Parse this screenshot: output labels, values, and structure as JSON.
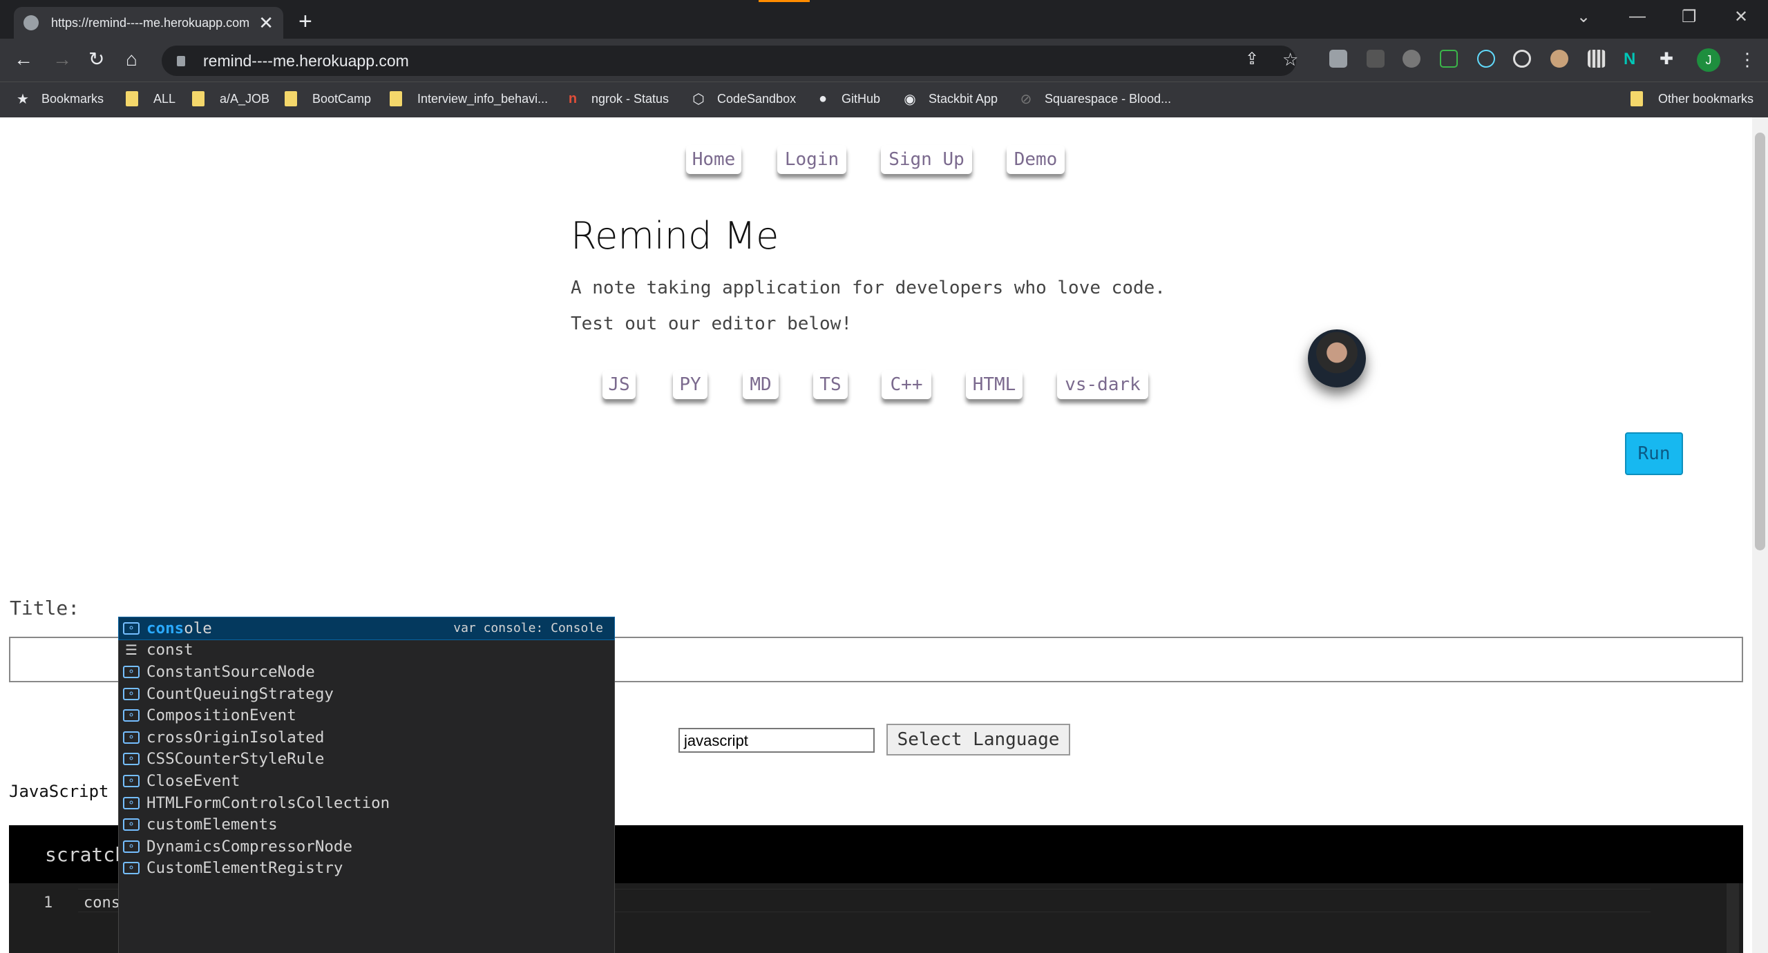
{
  "browser": {
    "tab_title": "https://remind----me.herokuapp.com",
    "tab_close": "✕",
    "new_tab": "+",
    "url": "remind----me.herokuapp.com",
    "profile_initial": "J",
    "bookmarks": [
      {
        "label": "Bookmarks",
        "icon": "star-icon"
      },
      {
        "label": "ALL",
        "icon": "folder-icon"
      },
      {
        "label": "a/A_JOB",
        "icon": "folder-icon"
      },
      {
        "label": "BootCamp",
        "icon": "folder-icon"
      },
      {
        "label": "Interview_info_behavi...",
        "icon": "folder-icon"
      },
      {
        "label": "ngrok - Status",
        "icon": "ngrok-icon"
      },
      {
        "label": "CodeSandbox",
        "icon": "codesandbox-icon"
      },
      {
        "label": "GitHub",
        "icon": "github-icon"
      },
      {
        "label": "Stackbit App",
        "icon": "stackbit-icon"
      },
      {
        "label": "Squarespace - Blood...",
        "icon": "squarespace-icon"
      }
    ],
    "other_bookmarks": "Other bookmarks"
  },
  "nav": {
    "home": "Home",
    "login": "Login",
    "signup": "Sign Up",
    "demo": "Demo"
  },
  "hero": {
    "title": "Remind Me",
    "tagline1": "A note taking application for developers who love code.",
    "tagline2": "Test out our editor below!"
  },
  "languages": [
    "JS",
    "PY",
    "MD",
    "TS",
    "C++",
    "HTML",
    "vs-dark"
  ],
  "run_label": "Run",
  "form": {
    "title_label": "Title:",
    "title_value": "",
    "language_value": "javascript",
    "select_language": "Select Language",
    "current_language": "JavaScript"
  },
  "editor": {
    "tab_name": "scratch",
    "line_number": "1",
    "code": "cons"
  },
  "suggestions": [
    {
      "label": "console",
      "match": "cons",
      "rest": "ole",
      "kind": "variable",
      "detail": "var console: Console"
    },
    {
      "label": "const",
      "kind": "keyword"
    },
    {
      "label": "ConstantSourceNode",
      "kind": "variable"
    },
    {
      "label": "CountQueuingStrategy",
      "kind": "variable"
    },
    {
      "label": "CompositionEvent",
      "kind": "variable"
    },
    {
      "label": "crossOriginIsolated",
      "kind": "variable"
    },
    {
      "label": "CSSCounterStyleRule",
      "kind": "variable"
    },
    {
      "label": "CloseEvent",
      "kind": "variable"
    },
    {
      "label": "HTMLFormControlsCollection",
      "kind": "variable"
    },
    {
      "label": "customElements",
      "kind": "variable"
    },
    {
      "label": "DynamicsCompressorNode",
      "kind": "variable"
    },
    {
      "label": "CustomElementRegistry",
      "kind": "variable"
    }
  ],
  "colors": {
    "run_button": "#17b8f0",
    "suggest_selected": "#04395e",
    "match_highlight": "#2aaaff"
  }
}
